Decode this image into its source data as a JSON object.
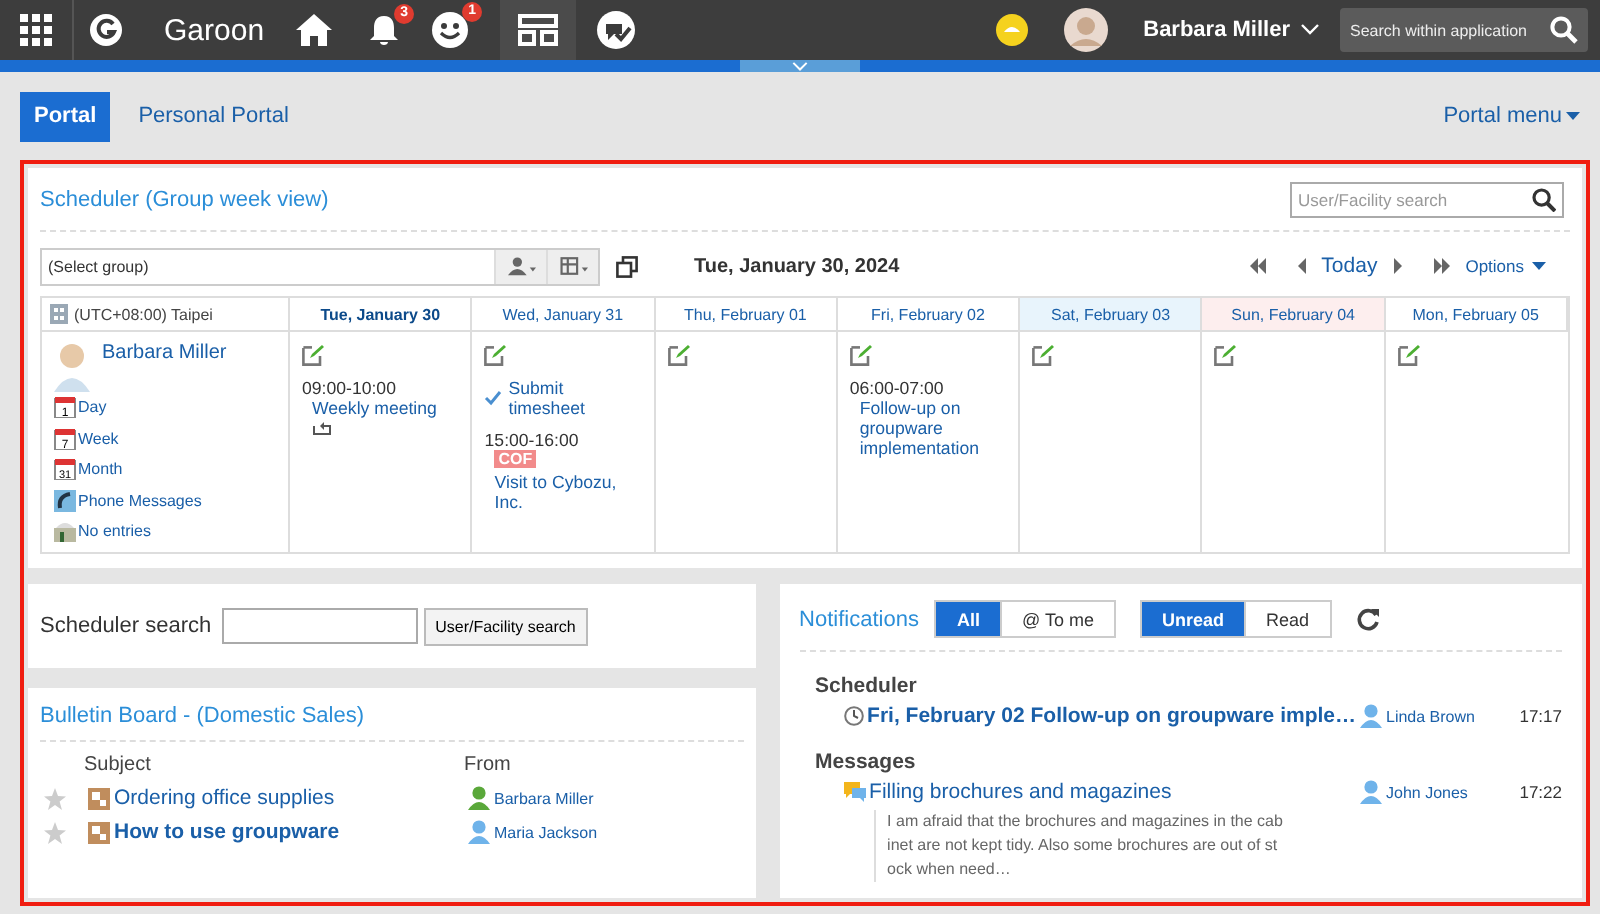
{
  "header": {
    "logo": "Garoon",
    "notifications_badge": "3",
    "reactions_badge": "1",
    "user_name": "Barbara Miller",
    "search": {
      "placeholder": "Search within application"
    }
  },
  "tabs": [
    {
      "label": "Portal",
      "selected": true
    },
    {
      "label": "Personal Portal",
      "selected": false
    }
  ],
  "portal_menu": "Portal menu",
  "scheduler": {
    "title": "Scheduler (Group week view)",
    "search": {
      "placeholder": "User/Facility search"
    },
    "group_select": "(Select group)",
    "date": "Tue, January 30, 2024",
    "today": "Today",
    "options": "Options",
    "timezone": "(UTC+08:00) Taipei",
    "days": [
      {
        "label": "Tue, January 30",
        "kind": "today"
      },
      {
        "label": "Wed, January 31",
        "kind": "weekday"
      },
      {
        "label": "Thu, February 01",
        "kind": "weekday"
      },
      {
        "label": "Fri, February 02",
        "kind": "weekday"
      },
      {
        "label": "Sat, February 03",
        "kind": "saturday"
      },
      {
        "label": "Sun, February 04",
        "kind": "sunday"
      },
      {
        "label": "Mon, February 05",
        "kind": "weekday"
      }
    ],
    "user": {
      "name": "Barbara Miller",
      "links": [
        {
          "label": "Day",
          "kind": "day",
          "icon_label": "1"
        },
        {
          "label": "Week",
          "kind": "week",
          "icon_label": "7"
        },
        {
          "label": "Month",
          "kind": "month",
          "icon_label": "31"
        },
        {
          "label": "Phone Messages",
          "kind": "phone"
        },
        {
          "label": "No entries",
          "kind": "presence"
        }
      ]
    },
    "cells": [
      [
        {
          "kind": "event",
          "time": "09:00-10:00",
          "title": "Weekly meeting",
          "repeat": true
        }
      ],
      [
        {
          "kind": "todo",
          "title": "Submit timesheet"
        },
        {
          "kind": "event",
          "time": "15:00-16:00",
          "tag": "COF",
          "title": "Visit to Cybozu, Inc."
        }
      ],
      [],
      [
        {
          "kind": "event",
          "time": "06:00-07:00",
          "title": "Follow-up on groupware implementation"
        }
      ],
      [],
      [],
      []
    ]
  },
  "scheduler_search": {
    "label": "Scheduler search",
    "button": "User/Facility search"
  },
  "bulletin": {
    "title": "Bulletin Board - (Domestic Sales)",
    "columns": [
      "Subject",
      "From"
    ],
    "rows": [
      {
        "subject": "Ordering office supplies",
        "from": "Barbara Miller",
        "unread": false,
        "color": "#5aa83a"
      },
      {
        "subject": "How to use groupware",
        "from": "Maria Jackson",
        "unread": true,
        "color": "#6fb3ea"
      }
    ]
  },
  "notifications": {
    "title": "Notifications",
    "filters": [
      {
        "label": "All",
        "selected": true
      },
      {
        "label": "@ To me",
        "selected": false
      }
    ],
    "read_filters": [
      {
        "label": "Unread",
        "selected": true
      },
      {
        "label": "Read",
        "selected": false
      }
    ],
    "groups": [
      {
        "title": "Scheduler",
        "items": [
          {
            "kind": "schedule",
            "title": "Fri, February 02 Follow-up on groupware imple…",
            "unread": true,
            "sender": "Linda Brown",
            "time": "17:17"
          }
        ]
      },
      {
        "title": "Messages",
        "items": [
          {
            "kind": "message",
            "title": "Filling brochures and magazines",
            "unread": false,
            "sender": "John Jones",
            "time": "17:22",
            "body": "I am afraid that the brochures and magazines in the cab inet are not kept tidy. Also some brochures are out of st ock when need…"
          }
        ]
      }
    ]
  }
}
